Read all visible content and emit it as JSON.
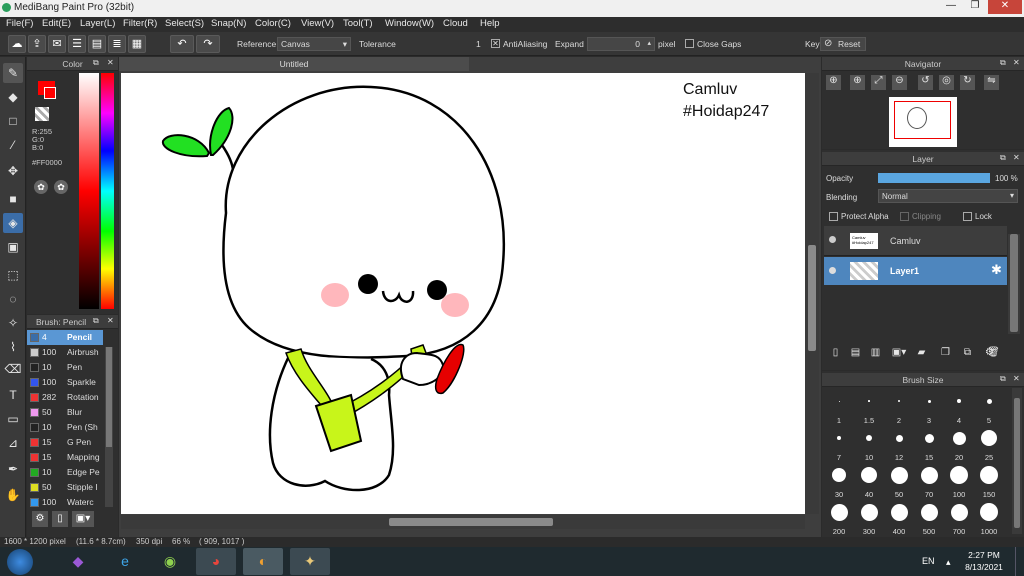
{
  "window": {
    "title": "MediBang Paint Pro (32bit)",
    "minimize": "—",
    "maximize": "❐",
    "close": "✕"
  },
  "menu": [
    "File(F)",
    "Edit(E)",
    "Layer(L)",
    "Filter(R)",
    "Select(S)",
    "Snap(N)",
    "Color(C)",
    "View(V)",
    "Tool(T)",
    "Window(W)",
    "Cloud",
    "Help"
  ],
  "toolbar": {
    "reference_label": "Reference",
    "reference_value": "Canvas",
    "tolerance_label": "Tolerance",
    "tolerance_value": "1",
    "antialiasing_label": "AntiAliasing",
    "antialiasing_checked": true,
    "expand_label": "Expand",
    "expand_value": "0",
    "expand_unit": "pixel",
    "close_gaps_label": "Close Gaps",
    "key_label": "Key",
    "reset_label": "Reset"
  },
  "color_panel": {
    "title": "Color",
    "rgb": {
      "r": "R:255",
      "g": "G:0",
      "b": "B:0"
    },
    "hex": "#FF0000",
    "primary": "#ff0000",
    "secondary": "#ffffff"
  },
  "brush_panel": {
    "title": "Brush: Pencil",
    "items": [
      {
        "num": "4",
        "name": "Pencil",
        "color": "#3a6da8",
        "selected": true
      },
      {
        "num": "100",
        "name": "Airbrush",
        "color": "#cccccc"
      },
      {
        "num": "10",
        "name": "Pen",
        "color": "#222222"
      },
      {
        "num": "100",
        "name": "Sparkle",
        "color": "#3355ee"
      },
      {
        "num": "282",
        "name": "Rotation",
        "color": "#ee3333"
      },
      {
        "num": "50",
        "name": "Blur",
        "color": "#ee99ee"
      },
      {
        "num": "10",
        "name": "Pen (Sh",
        "color": "#222222"
      },
      {
        "num": "15",
        "name": "G Pen",
        "color": "#ee3333"
      },
      {
        "num": "15",
        "name": "Mapping",
        "color": "#ee3333"
      },
      {
        "num": "10",
        "name": "Edge Pe",
        "color": "#22aa22"
      },
      {
        "num": "50",
        "name": "Stipple I",
        "color": "#dddd22"
      },
      {
        "num": "100",
        "name": "Waterc",
        "color": "#3399ee"
      }
    ]
  },
  "document": {
    "tab": "Untitled",
    "caption_line1": "Camluv",
    "caption_line2": "#Hoidap247"
  },
  "navigator": {
    "title": "Navigator"
  },
  "layer_panel": {
    "title": "Layer",
    "opacity_label": "Opacity",
    "opacity_value": "100 %",
    "opacity_fraction": 1.0,
    "blending_label": "Blending",
    "blending_value": "Normal",
    "protect_alpha": "Protect Alpha",
    "clipping": "Clipping",
    "lock": "Lock",
    "layers": [
      {
        "name": "Camluv",
        "thumb": "Camluv\n#Hoidap247",
        "selected": false
      },
      {
        "name": "Layer1",
        "selected": true
      }
    ]
  },
  "brush_size": {
    "title": "Brush Size",
    "sizes": [
      "1",
      "1.5",
      "2",
      "3",
      "4",
      "5",
      "7",
      "10",
      "12",
      "15",
      "20",
      "25",
      "30",
      "40",
      "50",
      "70",
      "100",
      "150",
      "200",
      "300",
      "400",
      "500",
      "700",
      "1000"
    ]
  },
  "status": {
    "size": "1600 * 1200 pixel",
    "physical": "(11.6 * 8.7cm)",
    "dpi": "350 dpi",
    "zoom": "66 %",
    "coords": "( 909, 1017 )"
  },
  "taskbar": {
    "lang": "EN",
    "time": "2:27 PM",
    "date": "8/13/2021"
  }
}
